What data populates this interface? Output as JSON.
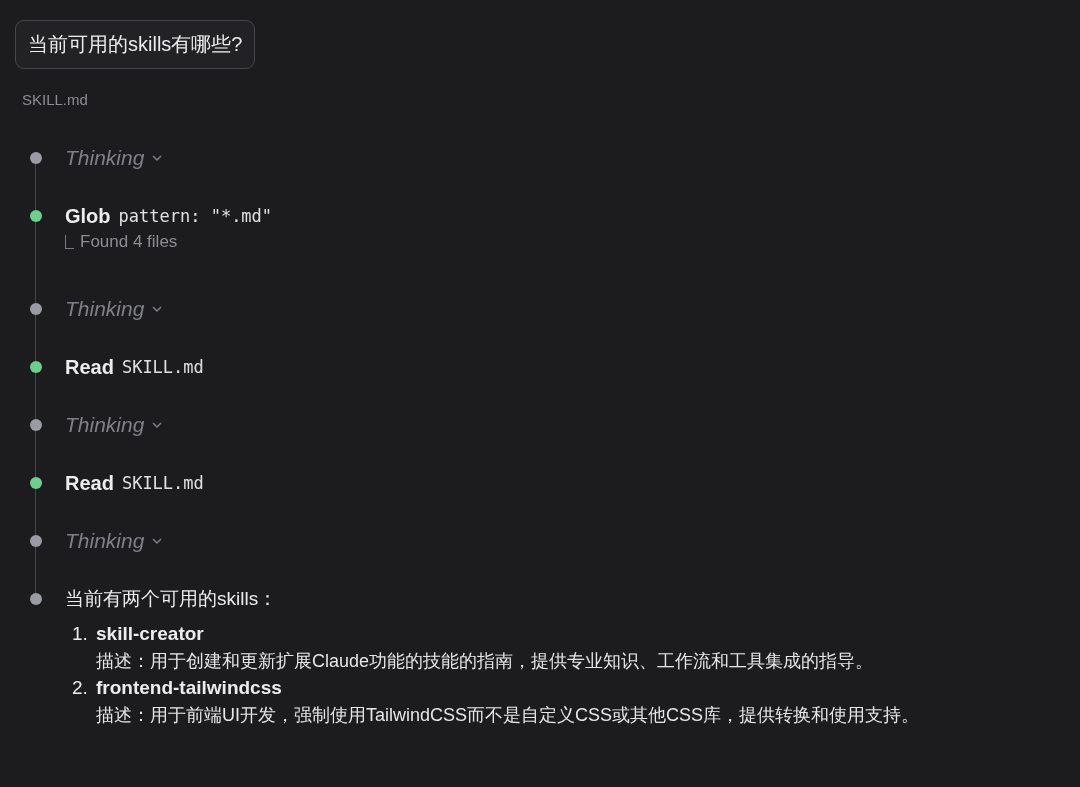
{
  "question": "当前可用的skills有哪些?",
  "attachment": "SKILL.md",
  "steps": [
    {
      "kind": "thinking",
      "label": "Thinking",
      "color": "#9a9ba3"
    },
    {
      "kind": "tool",
      "name": "Glob",
      "args": "pattern: \"*.md\"",
      "result": "Found 4 files",
      "color": "#6ccf8e"
    },
    {
      "kind": "thinking",
      "label": "Thinking",
      "color": "#9a9ba3"
    },
    {
      "kind": "tool",
      "name": "Read",
      "args": "SKILL.md",
      "color": "#6ccf8e"
    },
    {
      "kind": "thinking",
      "label": "Thinking",
      "color": "#9a9ba3"
    },
    {
      "kind": "tool",
      "name": "Read",
      "args": "SKILL.md",
      "color": "#6ccf8e"
    },
    {
      "kind": "thinking",
      "label": "Thinking",
      "color": "#9a9ba3"
    },
    {
      "kind": "message",
      "text": "当前有两个可用的skills：",
      "color": "#9a9ba3"
    }
  ],
  "answer_list": [
    {
      "number": "1.",
      "title": "skill-creator",
      "description": "描述：用于创建和更新扩展Claude功能的技能的指南，提供专业知识、工作流和工具集成的指导。"
    },
    {
      "number": "2.",
      "title": "frontend-tailwindcss",
      "description": "描述：用于前端UI开发，强制使用TailwindCSS而不是自定义CSS或其他CSS库，提供转换和使用支持。"
    }
  ]
}
